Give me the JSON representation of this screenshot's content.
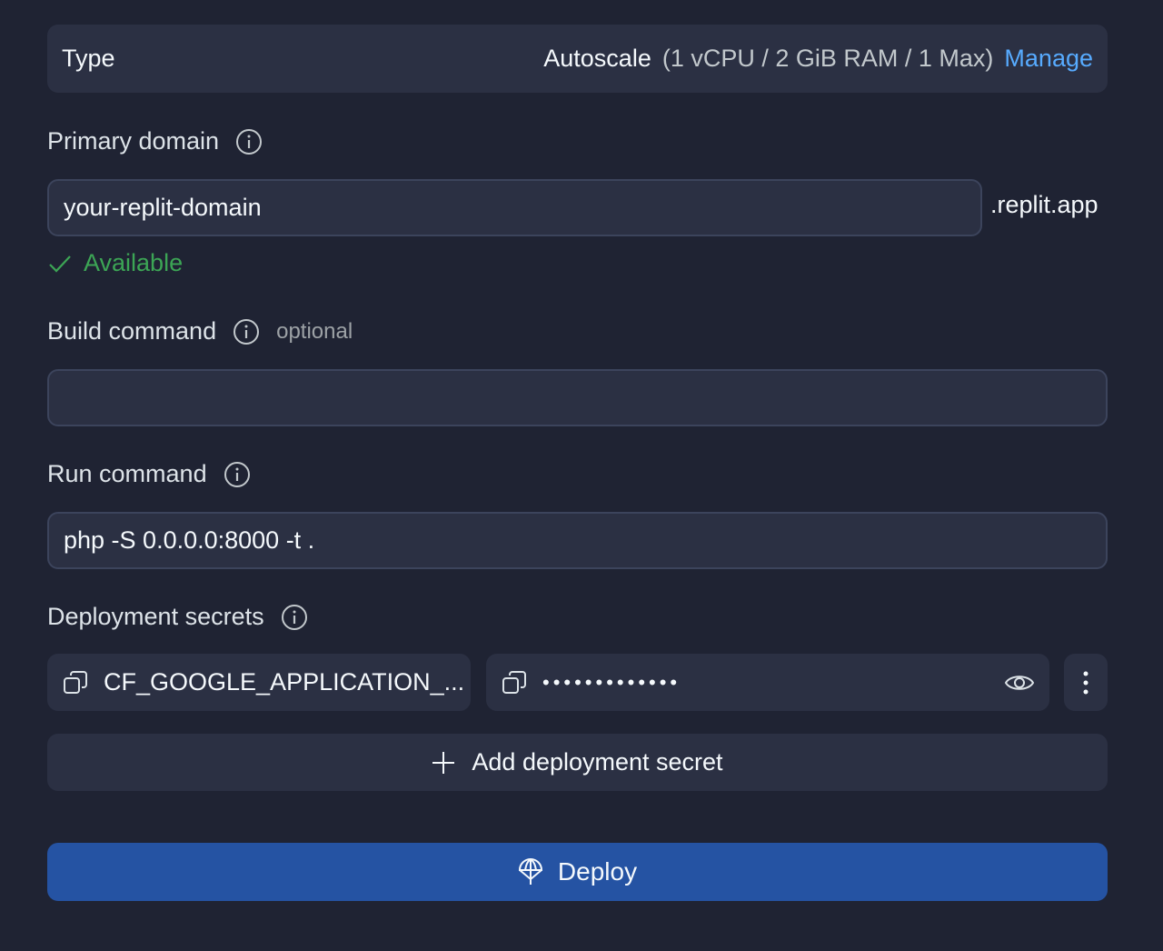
{
  "type_row": {
    "label": "Type",
    "value": "Autoscale",
    "detail": "(1 vCPU / 2 GiB RAM / 1 Max)",
    "manage_label": "Manage"
  },
  "primary_domain": {
    "label": "Primary domain",
    "value": "your-replit-domain",
    "suffix": ".replit.app",
    "status": "Available",
    "status_color": "#3ca555"
  },
  "build_command": {
    "label": "Build command",
    "optional_label": "optional",
    "value": ""
  },
  "run_command": {
    "label": "Run command",
    "value": "php -S 0.0.0.0:8000 -t ."
  },
  "deployment_secrets": {
    "label": "Deployment secrets",
    "items": [
      {
        "key": "CF_GOOGLE_APPLICATION_...",
        "value_masked": "•••••••••••••"
      }
    ],
    "add_label": "Add deployment secret"
  },
  "deploy_button": {
    "label": "Deploy",
    "color": "#2553a3"
  },
  "colors": {
    "background": "#1f2333",
    "panel": "#2b3043",
    "link": "#57abff"
  },
  "icons": [
    "info-icon",
    "check-icon",
    "copy-icon",
    "eye-icon",
    "more-vertical-icon",
    "plus-icon",
    "deploy-icon"
  ]
}
